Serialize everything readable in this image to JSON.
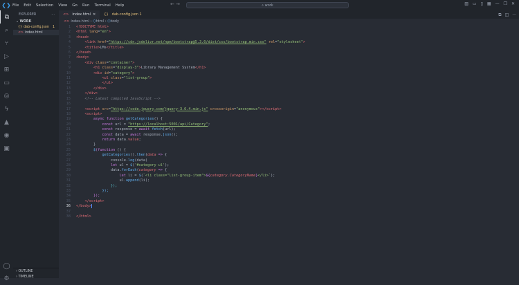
{
  "menu": [
    "File",
    "Edit",
    "Selection",
    "View",
    "Go",
    "Run",
    "Terminal",
    "Help"
  ],
  "search": "work",
  "explorer": {
    "title": "EXPLORER",
    "folder": "WORK",
    "files": [
      {
        "name": "dab-config.json",
        "badge": "1"
      },
      {
        "name": "index.html"
      }
    ],
    "outline": "OUTLINE",
    "timeline": "TIMELINE"
  },
  "tabs": [
    {
      "label": "index.html"
    },
    {
      "label": "dab-config.json 1"
    }
  ],
  "breadcrumb": [
    "index.html",
    "html",
    "body"
  ],
  "current_line": 36,
  "code": [
    [
      [
        "t",
        "<!DOCTYPE html>"
      ]
    ],
    [
      [
        "t",
        "<html "
      ],
      [
        "a",
        "lang"
      ],
      [
        "p",
        "="
      ],
      [
        "sv",
        "\"en\""
      ],
      [
        "t",
        ">"
      ]
    ],
    [
      [
        "t",
        "<head>"
      ]
    ],
    [
      [
        "p",
        "    "
      ],
      [
        "t",
        "<link "
      ],
      [
        "a",
        "href"
      ],
      [
        "p",
        "="
      ],
      [
        "s",
        "\"https://cdn.jsdelivr.net/npm/bootstrap@5.3.0/dist/css/bootstrap.min.css\""
      ],
      [
        "p",
        " "
      ],
      [
        "a",
        "rel"
      ],
      [
        "p",
        "="
      ],
      [
        "sv",
        "\"stylesheet\""
      ],
      [
        "t",
        ">"
      ]
    ],
    [
      [
        "p",
        "    "
      ],
      [
        "t",
        "<title>"
      ],
      [
        "p",
        "LMs"
      ],
      [
        "t",
        "</title>"
      ]
    ],
    [
      [
        "t",
        "</head>"
      ]
    ],
    [
      [
        "t",
        "<body>"
      ]
    ],
    [
      [
        "p",
        "    "
      ],
      [
        "t",
        "<div "
      ],
      [
        "a",
        "class"
      ],
      [
        "p",
        "="
      ],
      [
        "sv",
        "\"container\""
      ],
      [
        "t",
        ">"
      ]
    ],
    [
      [
        "p",
        "        "
      ],
      [
        "t",
        "<h1 "
      ],
      [
        "a",
        "class"
      ],
      [
        "p",
        "="
      ],
      [
        "sv",
        "\"display-3\""
      ],
      [
        "t",
        ">"
      ],
      [
        "p",
        "Library Management System"
      ],
      [
        "t",
        "</h1>"
      ]
    ],
    [
      [
        "p",
        "        "
      ],
      [
        "t",
        "<div "
      ],
      [
        "a",
        "id"
      ],
      [
        "p",
        "="
      ],
      [
        "sv",
        "\"category\""
      ],
      [
        "t",
        ">"
      ]
    ],
    [
      [
        "p",
        "            "
      ],
      [
        "t",
        "<ul "
      ],
      [
        "a",
        "class"
      ],
      [
        "p",
        "="
      ],
      [
        "sv",
        "\"list-group\""
      ],
      [
        "t",
        ">"
      ]
    ],
    [
      [
        "p",
        "            "
      ],
      [
        "t",
        "</ul>"
      ]
    ],
    [
      [
        "p",
        "        "
      ],
      [
        "t",
        "</div>"
      ]
    ],
    [
      [
        "p",
        "    "
      ],
      [
        "t",
        "</div>"
      ]
    ],
    [
      [
        "p",
        "    "
      ],
      [
        "c",
        "<!-- Latest compiled JavaScript -->"
      ]
    ],
    [],
    [
      [
        "p",
        "    "
      ],
      [
        "t",
        "<script "
      ],
      [
        "a",
        "src"
      ],
      [
        "p",
        "="
      ],
      [
        "s",
        "\"https://code.jquery.com/jquery-3.6.4.min.js\""
      ],
      [
        "p",
        " "
      ],
      [
        "a",
        "crossorigin"
      ],
      [
        "p",
        "="
      ],
      [
        "sv",
        "\"anonymous\""
      ],
      [
        "t",
        "></script>"
      ]
    ],
    [
      [
        "p",
        "    "
      ],
      [
        "t",
        "<script>"
      ]
    ],
    [
      [
        "p",
        "        "
      ],
      [
        "k",
        "async function "
      ],
      [
        "f",
        "getCategories"
      ],
      [
        "p",
        "() {"
      ]
    ],
    [
      [
        "p",
        "            "
      ],
      [
        "k",
        "const "
      ],
      [
        "p",
        "url = "
      ],
      [
        "s",
        "\"https://localhost:5001/api/Category\""
      ],
      [
        "p",
        ";"
      ]
    ],
    [
      [
        "p",
        "            "
      ],
      [
        "k",
        "const "
      ],
      [
        "p",
        "response = "
      ],
      [
        "k",
        "await "
      ],
      [
        "f",
        "fetch"
      ],
      [
        "p",
        "(url);"
      ]
    ],
    [
      [
        "p",
        "            "
      ],
      [
        "k",
        "const "
      ],
      [
        "p",
        "data = "
      ],
      [
        "k",
        "await "
      ],
      [
        "p",
        "response."
      ],
      [
        "f",
        "json"
      ],
      [
        "p",
        "();"
      ]
    ],
    [
      [
        "p",
        "            "
      ],
      [
        "k",
        "return "
      ],
      [
        "p",
        "data."
      ],
      [
        "t",
        "value"
      ],
      [
        "p",
        ";"
      ]
    ],
    [
      [
        "p",
        "        }"
      ]
    ],
    [
      [
        "p",
        "        "
      ],
      [
        "f",
        "$"
      ],
      [
        "k",
        "(function "
      ],
      [
        "p",
        "() {"
      ]
    ],
    [
      [
        "p",
        "            "
      ],
      [
        "f",
        "getCategories"
      ],
      [
        "p",
        "()."
      ],
      [
        "f",
        "then"
      ],
      [
        "p",
        "("
      ],
      [
        "v",
        "data"
      ],
      [
        "k",
        " => "
      ],
      [
        "p",
        "{"
      ]
    ],
    [
      [
        "p",
        "                console."
      ],
      [
        "f",
        "log"
      ],
      [
        "p",
        "(data)"
      ]
    ],
    [
      [
        "p",
        "                "
      ],
      [
        "k",
        "let "
      ],
      [
        "p",
        "ul = "
      ],
      [
        "f",
        "$"
      ],
      [
        "p",
        "("
      ],
      [
        "sv",
        "'#category ul'"
      ],
      [
        "p",
        ");"
      ]
    ],
    [
      [
        "p",
        "                data."
      ],
      [
        "f",
        "forEach"
      ],
      [
        "p",
        "("
      ],
      [
        "v",
        "category"
      ],
      [
        "k",
        " => "
      ],
      [
        "p",
        "{"
      ]
    ],
    [
      [
        "p",
        "                    "
      ],
      [
        "k",
        "let "
      ],
      [
        "p",
        "li = "
      ],
      [
        "f",
        "$"
      ],
      [
        "p",
        "("
      ],
      [
        "sv",
        "`<li class=\"list-group-item\">"
      ],
      [
        "k",
        "${"
      ],
      [
        "v",
        "category.CategoryName"
      ],
      [
        "k",
        "}"
      ],
      [
        "sv",
        "</li>`"
      ],
      [
        "p",
        ");"
      ]
    ],
    [
      [
        "p",
        "                    ul."
      ],
      [
        "f",
        "append"
      ],
      [
        "p",
        "(li);"
      ]
    ],
    [
      [
        "p",
        "                "
      ],
      [
        "y",
        "});"
      ]
    ],
    [
      [
        "p",
        "            "
      ],
      [
        "f",
        "});"
      ]
    ],
    [
      [
        "p",
        "        "
      ],
      [
        "k",
        "});"
      ]
    ],
    [
      [
        "p",
        "    "
      ],
      [
        "t",
        "</script>"
      ]
    ],
    [
      [
        "t",
        "</body>"
      ]
    ],
    [],
    [
      [
        "t",
        "</html>"
      ]
    ]
  ]
}
